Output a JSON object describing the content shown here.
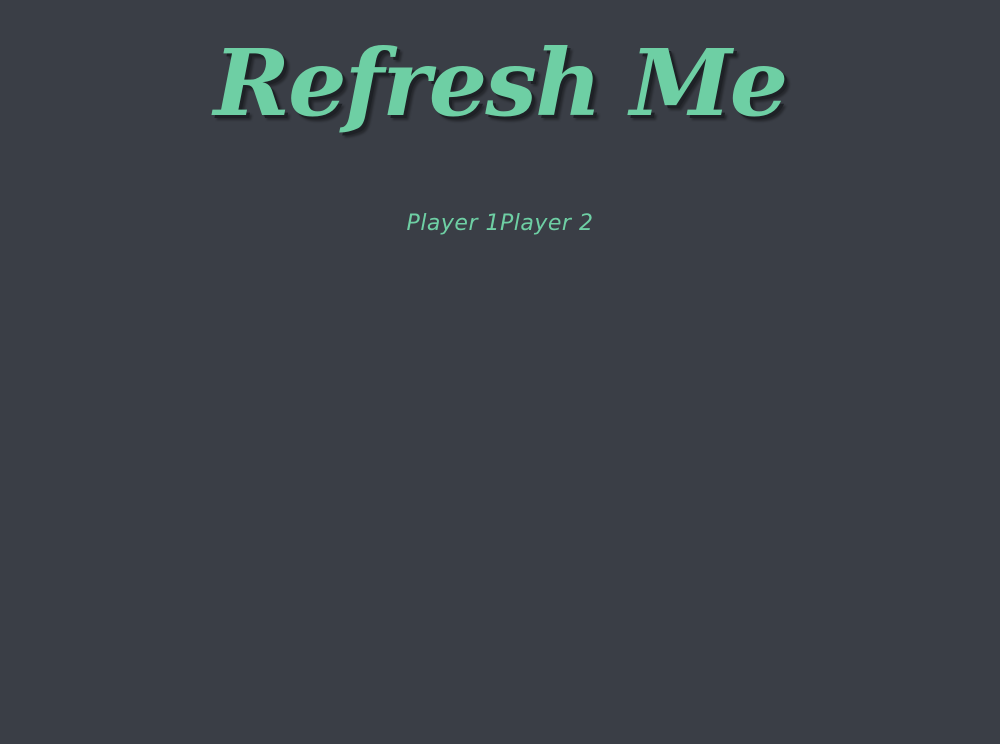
{
  "page": {
    "title": "Refresh Me",
    "players": [
      {
        "label": "Player 1"
      },
      {
        "label": "Player 2"
      }
    ]
  },
  "colors": {
    "background": "#3a3e46",
    "accent": "#6ecfa4",
    "title_shadow": "#1e2126"
  }
}
